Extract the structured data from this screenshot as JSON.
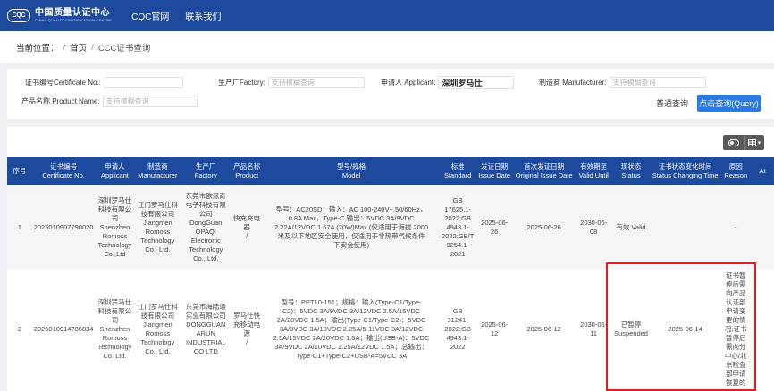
{
  "header": {
    "logo_mark": "CQC",
    "logo_cn": "中国质量认证中心",
    "logo_en": "CHINA QUALITY CERTIFICATION CENTRE",
    "nav": [
      "CQC官网",
      "联系我们"
    ]
  },
  "breadcrumb": {
    "label": "当前位置：",
    "sep": "/",
    "home": "首页",
    "current": "CCC证书查询"
  },
  "search": {
    "cert_label": "证书编号Certificate No.:",
    "cert_value": "",
    "factory_label": "生产厂Factory:",
    "factory_placeholder": "支持模糊查询",
    "applicant_label": "申请人 Applicant:",
    "applicant_value": "深圳罗马仕",
    "manufacturer_label": "制造商 Manufacturer:",
    "manufacturer_placeholder": "支持模糊查询",
    "product_label": "产品名称 Product Name:",
    "product_placeholder": "支持模糊查询",
    "btn_normal": "普通查询",
    "btn_query": "点击查询(Query)"
  },
  "toolbar": {
    "toggle_icon": "toggle-icon",
    "columns_icon": "columns-grid-icon",
    "caret": "▾"
  },
  "table": {
    "headers": [
      [
        "序号"
      ],
      [
        "证书编号",
        "Certificate No."
      ],
      [
        "申请人",
        "Applicant"
      ],
      [
        "制造商",
        "Manufacturer"
      ],
      [
        "生产厂",
        "Factory"
      ],
      [
        "产品名称",
        "Product"
      ],
      [
        "型号/规格",
        "Model"
      ],
      [
        "标准",
        "Standard"
      ],
      [
        "发证日期",
        "Issue Date"
      ],
      [
        "首次发证日期",
        "Original Issue Date"
      ],
      [
        "有效期至",
        "Valid Until"
      ],
      [
        "现状态",
        "Status"
      ],
      [
        "证书状态变化时间",
        "Status Changing Time"
      ],
      [
        "原因",
        "Reason"
      ],
      [
        "At"
      ]
    ],
    "rows": [
      {
        "no": "1",
        "cert": "2025010907790020",
        "applicant": [
          "深圳罗马仕",
          "科技有限公",
          "司",
          "Shenzhen",
          "Romoss",
          "Technology",
          "Co.,Ltd"
        ],
        "manufacturer": [
          "江门罗马仕科",
          "技有限公司",
          "Jiangmen",
          "Romoss",
          "Technology",
          "Co., Ltd."
        ],
        "factory": [
          "东莞市欧派奇",
          "电子科技有限",
          "公司",
          "DongGuan",
          "OPAQI",
          "Electronic",
          "Technology",
          "Co., Ltd."
        ],
        "product": [
          "快充充电",
          "器",
          "/"
        ],
        "model": [
          "型号：AC20SD；输入：AC 100-240V~,50/60Hz，",
          "0.8A Max，Type-C 输出：5VDC 3A/9VDC",
          "2.22A/12VDC 1.67A (20W)Max (仅适用于海拔 2000",
          "米及以下地区安全使用，仅适用于非热带气候条件",
          "下安全使用)"
        ],
        "standard": [
          "GB",
          "17625.1-",
          "2022;GB",
          "4943.1-",
          "2022;GB/T",
          "9254.1-",
          "2021"
        ],
        "issue_date": "2025-06-26",
        "original_issue": "2025-06-26",
        "valid_until": [
          "2030-06-",
          "08"
        ],
        "status": [
          "有效 Valid"
        ],
        "status_time": "",
        "reason": [
          "-"
        ],
        "at": ""
      },
      {
        "no": "2",
        "cert": "2025010914785834",
        "applicant": [
          "深圳罗马仕",
          "科技有限公",
          "司",
          "Shenzhen",
          "Romoss",
          "Technology",
          "Co. Ltd."
        ],
        "manufacturer": [
          "江门罗马仕科",
          "技有限公司",
          "Jiangmen",
          "Romoss",
          "Technology",
          "Co., Ltd."
        ],
        "factory": [
          "东莞市海陆通",
          "实业有限公司",
          "DONGGUAN",
          "ARUN",
          "INDUSTRIAL",
          "CO LTD"
        ],
        "product": [
          "罗马仕快",
          "充移动电",
          "源",
          "/"
        ],
        "model": [
          "型号：PPT10-151；规格：输入(Type-C1/Type-",
          "C2)：5VDC 3A/9VDC 3A/12VDC 2.5A/15VDC",
          "2A/20VDC 1.5A；输出(Type-C1/Type-C2)：5VDC",
          "3A/9VDC 3A/10VDC 2.25A/5-11VDC 3A/12VDC",
          "2.5A/15VDC 2A/20VDC 1.5A；输出(USB-A)：5VDC",
          "3A/9VDC 2A/10VDC 2.25A/12VDC 1.5A；总输出：",
          "Type-C1+Type-C2+USB-A=5VDC 3A"
        ],
        "standard": [
          "GB",
          "31241-",
          "2022;GB",
          "4943.1-",
          "2022"
        ],
        "issue_date": "2025-06-12",
        "original_issue": "2025-06-12",
        "valid_until": [
          "2030-06-",
          "11"
        ],
        "status": [
          "已暂停",
          "Suspended"
        ],
        "status_time": "2025-06-14",
        "reason": [
          "证书暂",
          "停后需",
          "向产品",
          "认证部",
          "申请变",
          "更的情",
          "况;证书",
          "暂停后",
          "需向分",
          "中心/北",
          "京检查",
          "部申请",
          "恢复的"
        ],
        "at": ""
      }
    ]
  }
}
